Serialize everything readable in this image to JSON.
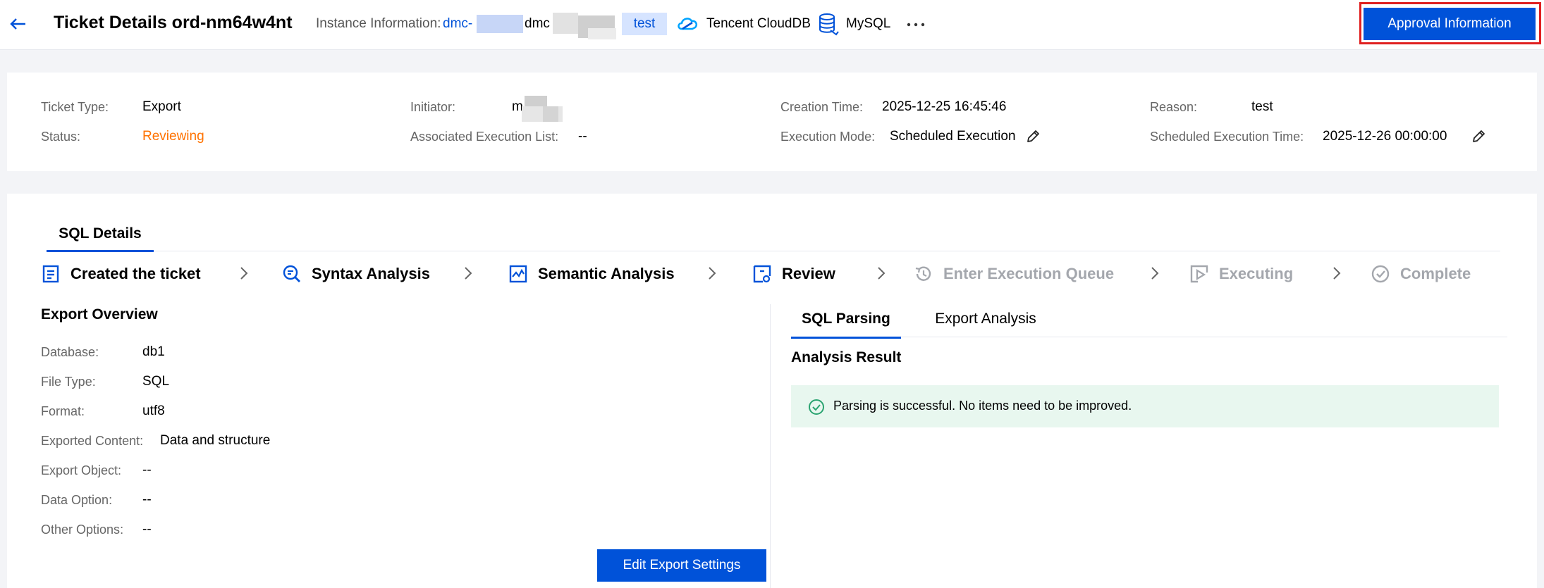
{
  "header": {
    "title": "Ticket Details ord-nm64w4nt",
    "instance_label": "Instance Information:",
    "instance_id": "dmc-",
    "instance_name": "dmc",
    "env_tag": "test",
    "cloud_label": "Tencent CloudDB",
    "db_type": "MySQL",
    "approval_button": "Approval Information",
    "icons": {
      "back": "back-arrow-icon",
      "cloud": "tencent-cloud-icon",
      "db": "mysql-icon",
      "more": "more-icon"
    }
  },
  "info": {
    "ticket_type_label": "Ticket Type",
    "ticket_type": "Export",
    "status_label": "Status",
    "status": "Reviewing",
    "initiator_label": "Initiator",
    "initiator": "m",
    "assoc_label": "Associated Execution List",
    "assoc_value": "--",
    "creation_label": "Creation Time",
    "creation_time": "2025-12-25 16:45:46",
    "exec_mode_label": "Execution Mode",
    "exec_mode": "Scheduled Execution",
    "reason_label": "Reason",
    "reason": "test",
    "sched_label": "Scheduled Execution Time",
    "sched_time": "2025-12-26 00:00:00"
  },
  "tabs": {
    "sql_details": "SQL Details"
  },
  "steps": [
    {
      "label": "Created the ticket",
      "state": "done"
    },
    {
      "label": "Syntax Analysis",
      "state": "done"
    },
    {
      "label": "Semantic Analysis",
      "state": "done"
    },
    {
      "label": "Review",
      "state": "done"
    },
    {
      "label": "Enter Execution Queue",
      "state": "todo"
    },
    {
      "label": "Executing",
      "state": "todo"
    },
    {
      "label": "Complete",
      "state": "todo"
    }
  ],
  "overview": {
    "title": "Export Overview",
    "rows": [
      {
        "label": "Database",
        "value": "db1"
      },
      {
        "label": "File Type",
        "value": "SQL"
      },
      {
        "label": "Format",
        "value": "utf8"
      },
      {
        "label": "Exported Content",
        "value": "Data and structure"
      },
      {
        "label": "Export Object",
        "value": "--"
      },
      {
        "label": "Data Option",
        "value": "--"
      },
      {
        "label": "Other Options",
        "value": "--"
      }
    ],
    "edit_button": "Edit Export Settings"
  },
  "analysis": {
    "tab_parsing": "SQL Parsing",
    "tab_export": "Export Analysis",
    "title": "Analysis Result",
    "message": "Parsing is successful. No items need to be improved."
  },
  "colors": {
    "primary": "#0052d9",
    "status_warning": "#ff7200",
    "success_bg": "#e8f7ef",
    "success": "#2ba471",
    "highlight_frame": "#e02020"
  }
}
